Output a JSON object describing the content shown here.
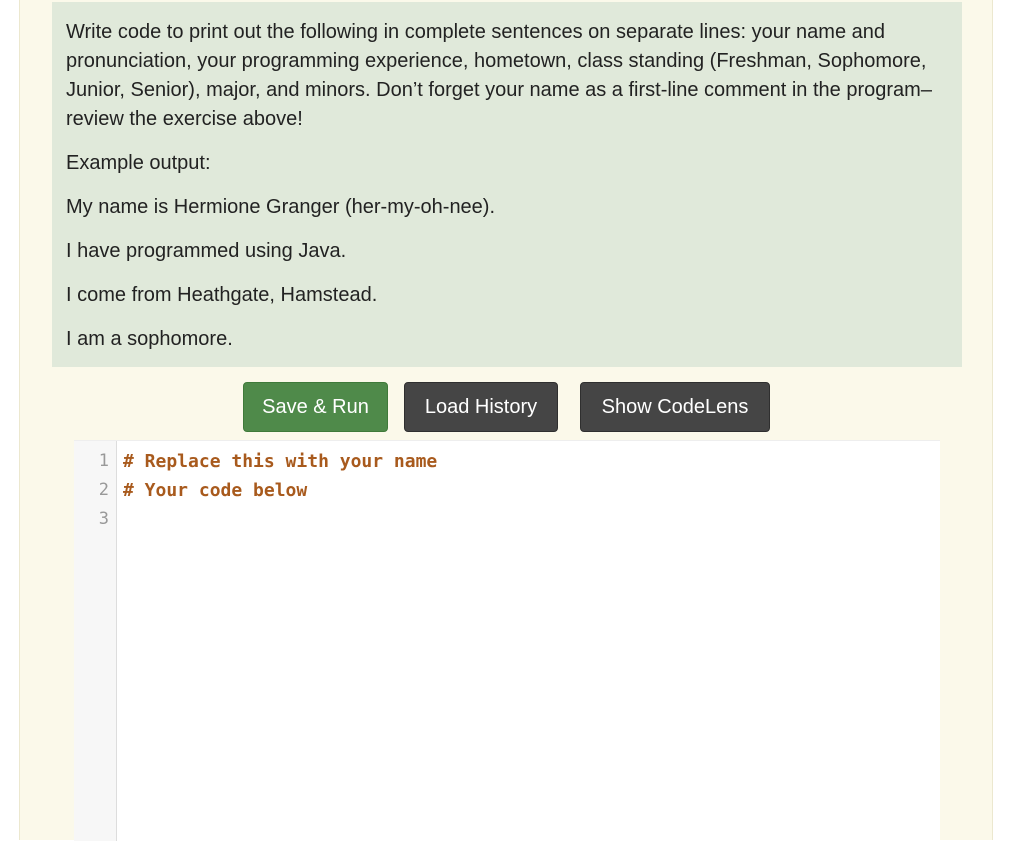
{
  "question": {
    "prompt": "Write code to print out the following in complete sentences on separate lines: your name and pronunciation, your programming experience, hometown, class standing (Freshman, Sophomore, Junior, Senior), major, and minors. Don’t forget your name as a first-line comment in the program–review the exercise above!",
    "example_label": "Example output:",
    "example_lines": [
      "My name is Hermione Granger (her-my-oh-nee).",
      "I have programmed using Java.",
      "I come from Heathgate, Hamstead.",
      "I am a sophomore."
    ]
  },
  "buttons": {
    "save_run": "Save & Run",
    "load_history": "Load History",
    "show_codelens": "Show CodeLens"
  },
  "editor": {
    "line_numbers": [
      "1",
      "2",
      "3"
    ],
    "lines": [
      "# Replace this with your name",
      "# Your code below",
      ""
    ]
  },
  "colors": {
    "save_run_bg": "#4f8a4a",
    "dark_button_bg": "#454545",
    "question_bg": "#e0e9da",
    "page_bg": "#fbf9ea",
    "comment_color": "#a85a1d"
  }
}
